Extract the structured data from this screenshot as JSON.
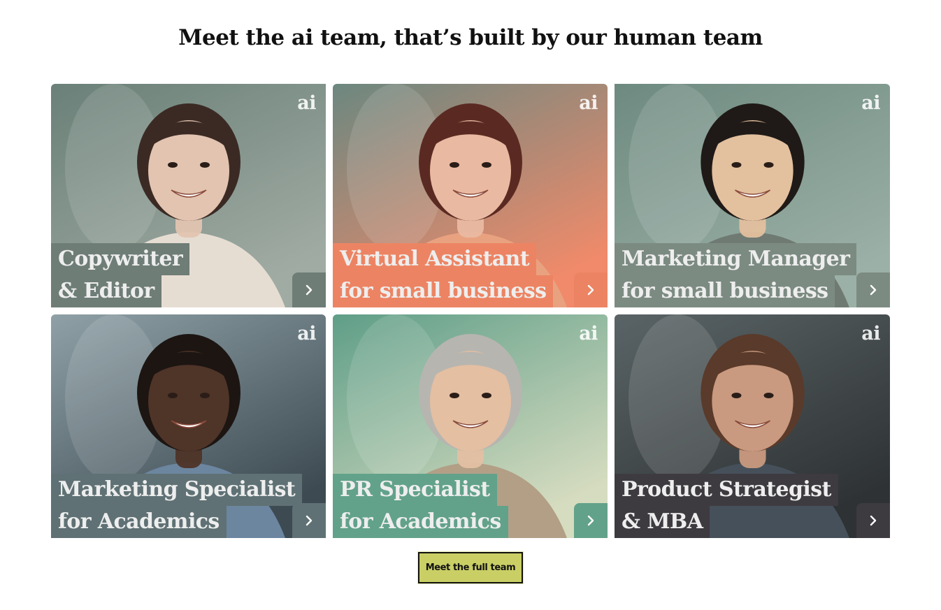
{
  "heading": "Meet the ai team, that’s built by our human team",
  "badge_text": "ai",
  "cards": [
    {
      "line1": "Copywriter",
      "line2": "& Editor",
      "label_color": "#6e7d76",
      "bg_top": "#6a8078",
      "bg_bottom": "#a0aba3",
      "skin": "#e2c4b0",
      "hair": "#3b2a24",
      "cloth": "#e6ddd2"
    },
    {
      "line1": "Virtual Assistant",
      "line2": "for small business",
      "label_color": "#ec8463",
      "bg_top": "#6c8880",
      "bg_bottom": "#f08a6a",
      "skin": "#eab9a1",
      "hair": "#5a2a22",
      "cloth": "#e9a280"
    },
    {
      "line1": "Marketing Manager",
      "line2": "for small business",
      "label_color": "#7c8b82",
      "bg_top": "#6e8a80",
      "bg_bottom": "#9bb0a6",
      "skin": "#e3c09e",
      "hair": "#1f1a17",
      "cloth": "#6f7a72"
    },
    {
      "line1": "Marketing Specialist",
      "line2": "for Academics",
      "label_color": "#5f7174",
      "bg_top": "#8fa1a7",
      "bg_bottom": "#3d4a52",
      "skin": "#4f3428",
      "hair": "#1c1512",
      "cloth": "#6c86a0"
    },
    {
      "line1": "PR Specialist",
      "line2": "for Academics",
      "label_color": "#62a28a",
      "bg_top": "#5f9e88",
      "bg_bottom": "#d6dcc0",
      "skin": "#e4bfa2",
      "hair": "#b7b5b0",
      "cloth": "#b29f86"
    },
    {
      "line1": "Product Strategist",
      "line2": "& MBA",
      "label_color": "#3d3b40",
      "bg_top": "#5a6466",
      "bg_bottom": "#2e3234",
      "skin": "#c99a80",
      "hair": "#5a3a2a",
      "cloth": "#46505a"
    }
  ],
  "cta_label": "Meet the full team"
}
